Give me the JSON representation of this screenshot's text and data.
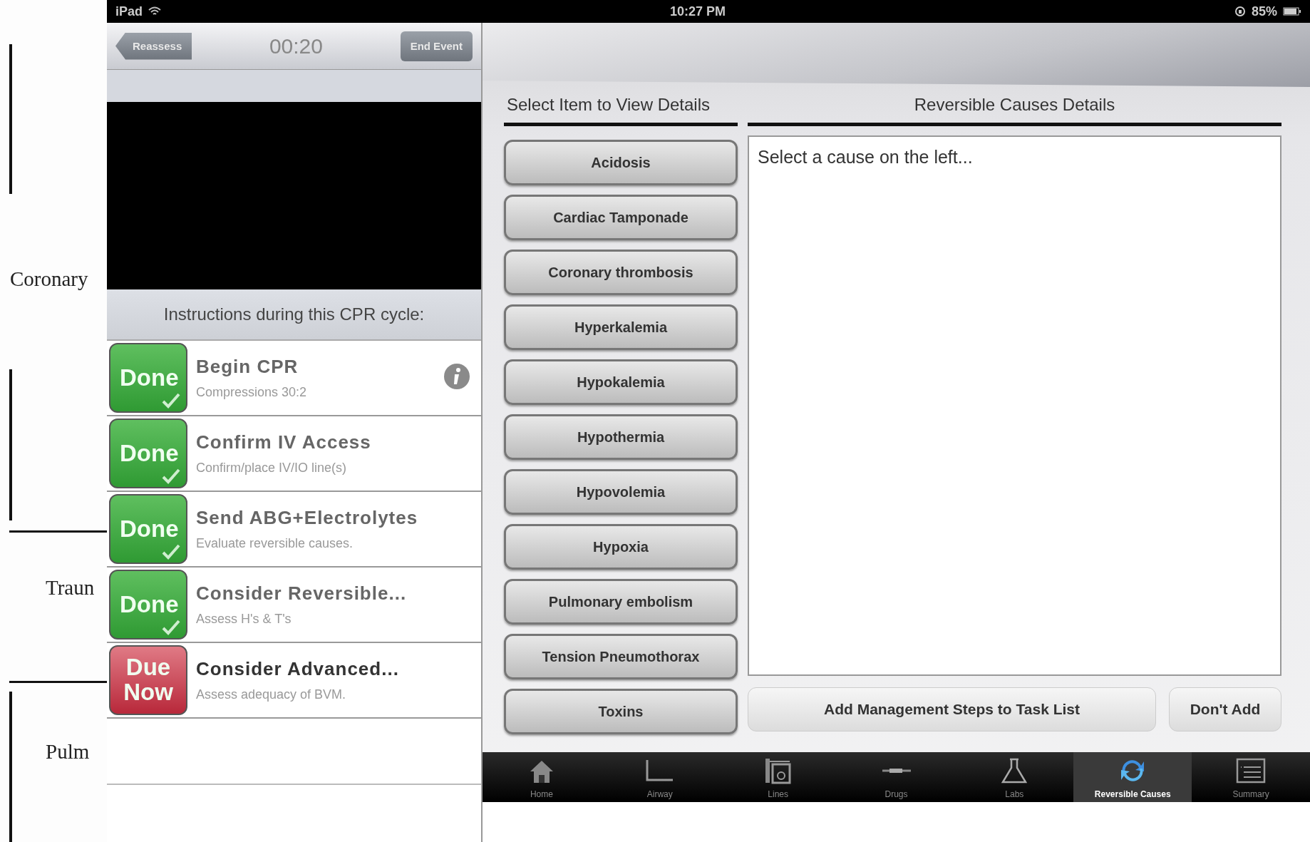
{
  "background_document": {
    "labels": [
      "Coronary",
      "Traun",
      "Pulm"
    ]
  },
  "status_bar": {
    "carrier": "iPad",
    "time": "10:27 PM",
    "battery": "85%"
  },
  "left_panel": {
    "back_button": "Reassess",
    "timer": "00:20",
    "end_button": "End Event",
    "instructions_header": "Instructions during this CPR cycle:",
    "tasks": [
      {
        "done": true,
        "badge": "Done",
        "title": "Begin CPR",
        "subtitle": "Compressions 30:2",
        "info": true
      },
      {
        "done": true,
        "badge": "Done",
        "title": "Confirm IV Access",
        "subtitle": "Confirm/place IV/IO line(s)",
        "info": false
      },
      {
        "done": true,
        "badge": "Done",
        "title": "Send ABG+Electrolytes",
        "subtitle": "Evaluate reversible causes.",
        "info": false
      },
      {
        "done": true,
        "badge": "Done",
        "title": "Consider Reversible...",
        "subtitle": "Assess H's & T's",
        "info": false
      },
      {
        "done": false,
        "badge": "Due Now",
        "title": "Consider Advanced...",
        "subtitle": "Assess adequacy of BVM.",
        "info": false
      }
    ]
  },
  "right_panel": {
    "list_header": "Select Item to View Details",
    "details_header": "Reversible Causes Details",
    "causes": [
      "Acidosis",
      "Cardiac Tamponade",
      "Coronary thrombosis",
      "Hyperkalemia",
      "Hypokalemia",
      "Hypothermia",
      "Hypovolemia",
      "Hypoxia",
      "Pulmonary embolism",
      "Tension Pneumothorax",
      "Toxins"
    ],
    "details_text": "Select a cause on the left...",
    "add_button": "Add Management Steps to Task List",
    "dont_add_button": "Don't Add"
  },
  "tab_bar": [
    {
      "kind": "home",
      "label": "Home",
      "selected": false
    },
    {
      "kind": "airway",
      "label": "Airway",
      "selected": false
    },
    {
      "kind": "lines",
      "label": "Lines",
      "selected": false
    },
    {
      "kind": "drugs",
      "label": "Drugs",
      "selected": false
    },
    {
      "kind": "labs",
      "label": "Labs",
      "selected": false
    },
    {
      "kind": "cycle",
      "label": "Reversible Causes",
      "selected": true
    },
    {
      "kind": "summary",
      "label": "Summary",
      "selected": false
    }
  ]
}
